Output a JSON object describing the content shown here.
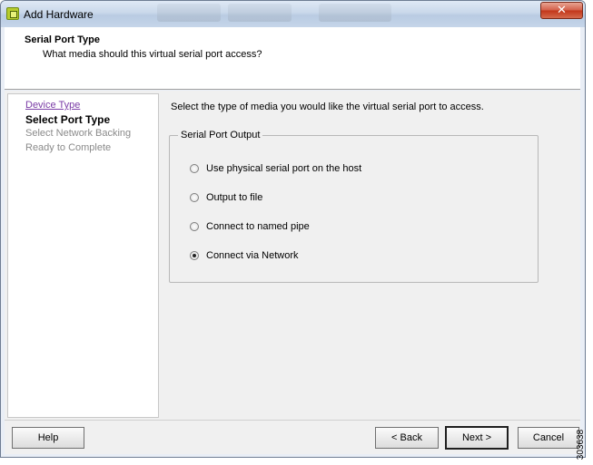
{
  "window": {
    "title": "Add Hardware",
    "close_symbol": "✕"
  },
  "header": {
    "title": "Serial Port Type",
    "subtitle": "What media should this virtual serial port access?"
  },
  "steps": [
    {
      "label": "Device Type",
      "state": "completed-link"
    },
    {
      "label": "Select Port Type",
      "state": "current"
    },
    {
      "label": "Select Network Backing",
      "state": "pending"
    },
    {
      "label": "Ready to Complete",
      "state": "pending"
    }
  ],
  "content": {
    "instruction": "Select the type of media you would like the virtual serial port to access.",
    "group_label": "Serial Port Output",
    "options": [
      {
        "label": "Use physical serial port on the host",
        "selected": false
      },
      {
        "label": "Output to file",
        "selected": false
      },
      {
        "label": "Connect to named pipe",
        "selected": false
      },
      {
        "label": "Connect via Network",
        "selected": true
      }
    ]
  },
  "buttons": {
    "help": "Help",
    "back": "< Back",
    "next": "Next >",
    "cancel": "Cancel"
  },
  "figure_id": "303638",
  "colors": {
    "link_visited": "#7a3ca6",
    "pending_step": "#8a8a8a",
    "close_button": "#c2361a"
  }
}
